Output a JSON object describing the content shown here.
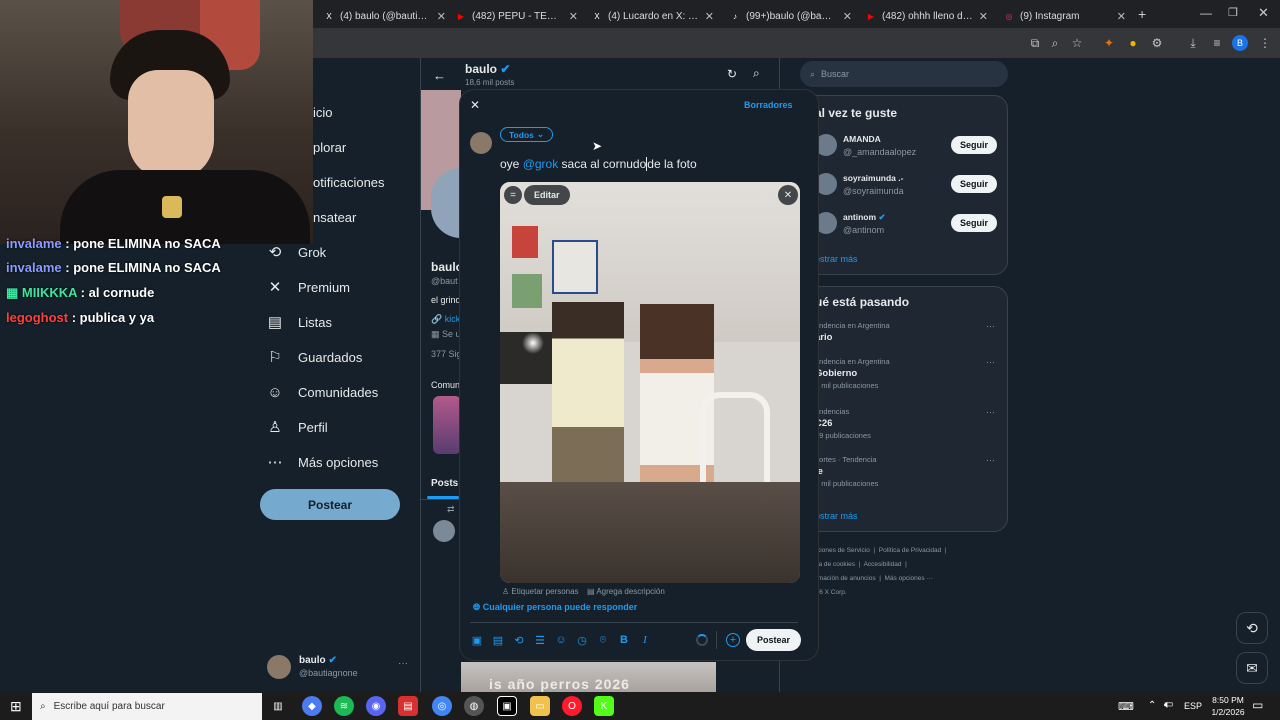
{
  "browser": {
    "tabs": [
      {
        "title": "(4) baulo (@bautiagnone)",
        "color": "#ffffff",
        "glyph": "X"
      },
      {
        "title": "(482) PEPU - TENGO UN P",
        "color": "#ff0000",
        "glyph": "▶"
      },
      {
        "title": "(4) Lucardo en X: \"ESUNA",
        "color": "#ffffff",
        "glyph": "X"
      },
      {
        "title": "(99+)baulo (@baulol) | Ti",
        "color": "#ffffff",
        "glyph": "♪"
      },
      {
        "title": "(482) ohhh lleno de mied",
        "color": "#ff0000",
        "glyph": "▶"
      },
      {
        "title": "(9) Instagram",
        "color": "#e1306c",
        "glyph": "◎"
      }
    ]
  },
  "nav": {
    "items": [
      {
        "label": "icio",
        "icon": "home-icon"
      },
      {
        "label": "plorar",
        "icon": "explore-icon"
      },
      {
        "label": "otificaciones",
        "icon": "bell-icon"
      },
      {
        "label": "nsatear",
        "icon": "mail-icon"
      },
      {
        "label": "Grok",
        "icon": "grok-icon"
      },
      {
        "label": "Premium",
        "icon": "x-icon"
      },
      {
        "label": "Listas",
        "icon": "list-icon"
      },
      {
        "label": "Guardados",
        "icon": "bookmark-icon"
      },
      {
        "label": "Comunidades",
        "icon": "people-icon"
      },
      {
        "label": "Perfil",
        "icon": "person-icon"
      },
      {
        "label": "Más opciones",
        "icon": "more-icon"
      }
    ],
    "post_button": "Postear",
    "account": {
      "name": "baulo",
      "handle": "@bautiagnone"
    }
  },
  "profile": {
    "name": "baulo",
    "posts_count": "18,6 mil posts",
    "name_partial": "baulo",
    "handle_partial": "@baut",
    "bio_partial": "el grind",
    "link_partial": "kick",
    "joined_partial": "Se u",
    "following_partial": "377 Sig",
    "communities_partial": "Comun",
    "tab_posts": "Posts",
    "bottom_text": "is año perros 2026"
  },
  "right": {
    "search_placeholder": "Buscar",
    "suggest_title": "al vez te guste",
    "suggestions": [
      {
        "name": "AMANDA",
        "handle": "@_amandaalopez",
        "button": "Seguir"
      },
      {
        "name": "soyraimunda .-",
        "handle": "@soyraimunda",
        "button": "Seguir"
      },
      {
        "name": "antinom",
        "handle": "@antinom",
        "button": "Seguir"
      }
    ],
    "show_more": "ostrar más",
    "trends_title": "ué está pasando",
    "trends": [
      {
        "context": "endencia en Argentina",
        "name": "ario",
        "count": ""
      },
      {
        "context": "endencia en Argentina",
        "name": "Gobierno",
        "count": "4 mil publicaciones"
      },
      {
        "context": "endencias",
        "name": "C26",
        "count": "29 publicaciones"
      },
      {
        "context": "portes · Tendencia",
        "name": "le",
        "count": "3 mil publicaciones"
      }
    ],
    "trends_more": "ostrar más",
    "footer": [
      "diciones de Servicio",
      "Política de Privacidad",
      "tica de cookies",
      "Accesibilidad",
      "ormación de anuncios",
      "Más opciones ···",
      "026 X Corp."
    ]
  },
  "composer": {
    "drafts": "Borradores",
    "audience": "Todos",
    "text_before": "oye ",
    "mention": "@grok",
    "text_after": " saca al cornudo",
    "text_end": "de la foto",
    "edit_label": "Editar",
    "tag_people": "Etiquetar personas",
    "add_description": "Agrega descripción",
    "reply_setting": "Cualquier persona puede responder",
    "post_button": "Postear"
  },
  "chat": [
    {
      "user": "invalame",
      "message": ": pone ELIMINA no SACA",
      "color": "#8a9cff"
    },
    {
      "user": "invalame",
      "message": ": pone ELIMINA no SACA",
      "color": "#8a9cff"
    },
    {
      "user": "MIIKKKA",
      "message": ": al cornude",
      "color": "#3ee6a0"
    },
    {
      "user": "legoghost",
      "message": ": publica y ya",
      "color": "#ff4040"
    }
  ],
  "taskbar": {
    "search_placeholder": "Escribe aquí para buscar",
    "lang": "ESP",
    "time": "8:50 PM",
    "date": "1/2/2026"
  }
}
